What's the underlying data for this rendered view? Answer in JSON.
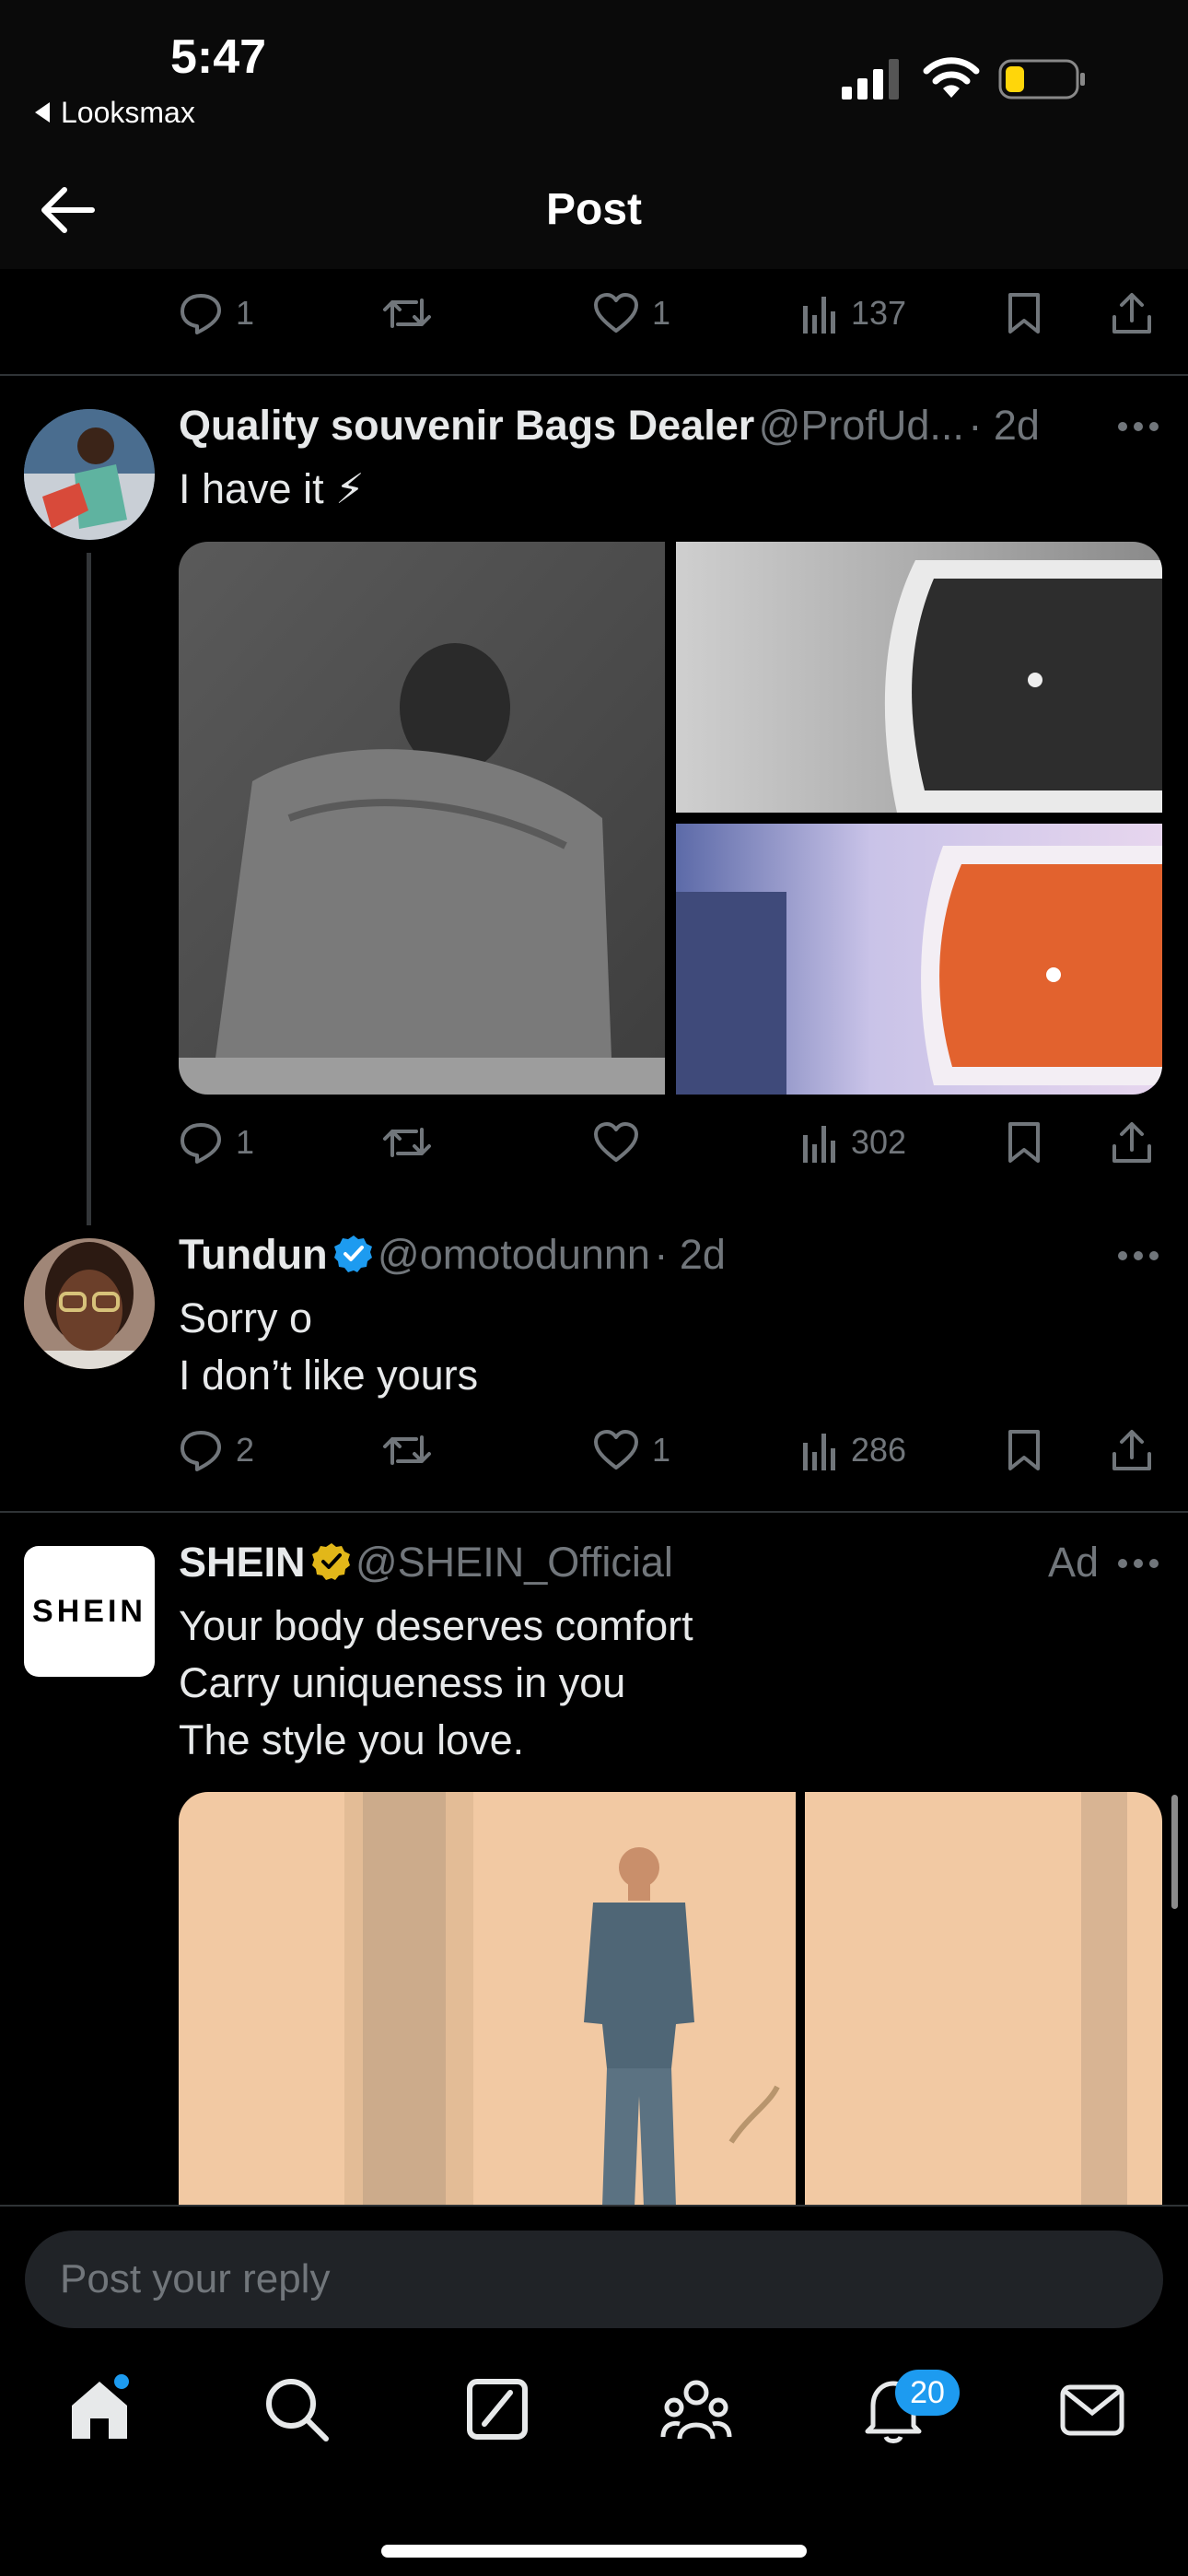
{
  "status_bar": {
    "time": "5:47",
    "back_app": "Looksmax"
  },
  "header": {
    "title": "Post"
  },
  "top_actions": {
    "replies": "1",
    "likes": "1",
    "views": "137"
  },
  "tweets": [
    {
      "name": "Quality souvenir Bags Dealer",
      "handle": "@ProfUd...",
      "time": "· 2d",
      "text": "I have it ⚡",
      "replies": "1",
      "retweets": "",
      "likes": "",
      "views": "302"
    },
    {
      "name": "Tundun",
      "handle": "@omotodunnn",
      "time": "· 2d",
      "text": "Sorry o\nI don’t like yours",
      "replies": "2",
      "retweets": "",
      "likes": "1",
      "views": "286"
    },
    {
      "name": "SHEIN",
      "handle": "@SHEIN_Official",
      "ad_label": "Ad",
      "avatar_text": "SHEIN",
      "text": "Your body deserves comfort\nCarry uniqueness in you\nThe style you love."
    }
  ],
  "reply": {
    "placeholder": "Post your reply"
  },
  "tabbar": {
    "notifications_badge": "20"
  },
  "colors": {
    "background": "#000000",
    "verified_blue": "#1d9bf0",
    "verified_gold": "#e2b719",
    "muted": "#71767b"
  }
}
